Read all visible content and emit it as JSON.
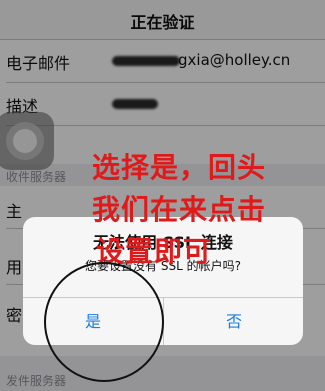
{
  "nav": {
    "title": "正在验证"
  },
  "fields": [
    {
      "label": "电子邮件",
      "value": "gxia@holley.cn"
    },
    {
      "label": "描述",
      "value": ""
    }
  ],
  "incoming_server": {
    "header": "收件服务器",
    "rows": [
      {
        "label": "主"
      },
      {
        "label": "用"
      },
      {
        "label": "密"
      }
    ]
  },
  "outgoing_server": {
    "header": "发件服务器"
  },
  "alert": {
    "title": "无法使用 SSL 连接",
    "message": "您要设置没有 SSL 的帐户吗?",
    "yes_label": "是",
    "no_label": "否"
  },
  "annotation": {
    "lines": [
      "选择是，回头",
      "我们在来点击",
      "设置即可"
    ],
    "color": "#e01a1a"
  },
  "colors": {
    "accent": "#1a7de0"
  },
  "icons": {
    "assistive_touch": "assistive-touch-icon"
  }
}
